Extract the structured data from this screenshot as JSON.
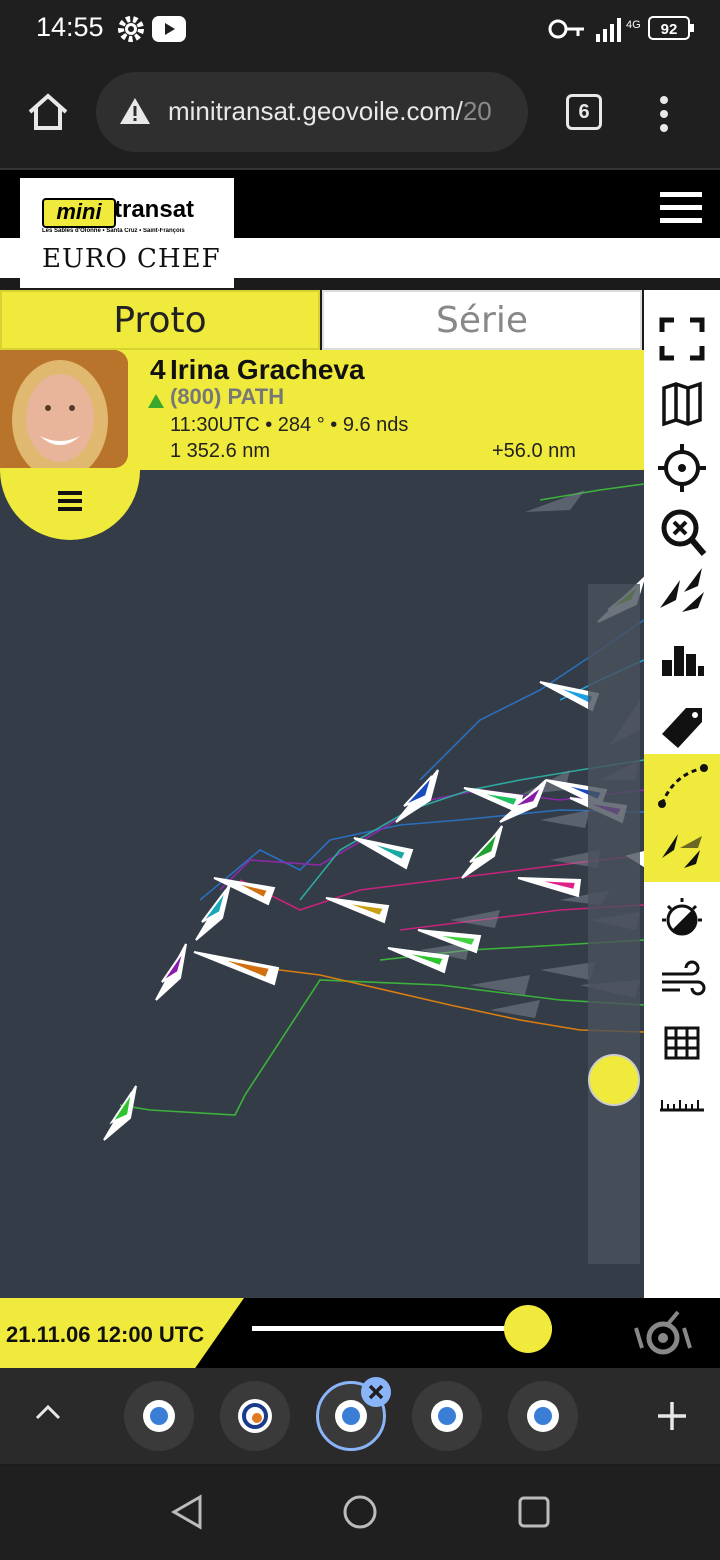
{
  "status_bar": {
    "time": "14:55",
    "network": "4G",
    "battery": "92"
  },
  "browser": {
    "url_main": "minitransat.geovoile.com/",
    "url_rest": "20",
    "tab_count": "6"
  },
  "site": {
    "logo_mini": "mini",
    "logo_transat": "transat",
    "logo_sub": "Les Sables d'Olonne • Santa Cruz • Saint-François",
    "sponsor": "EURO CHEF"
  },
  "tabs": {
    "proto": "Proto",
    "serie": "Série"
  },
  "skipper": {
    "rank": "4",
    "name": "Irina Gracheva",
    "boat": "(800) PATH",
    "info": "11:30UTC • 284 ° • 9.6 nds",
    "distance": "1 352.6 nm",
    "delta": "+56.0 nm"
  },
  "timeline": {
    "date": "21.11.06 12:00 UTC",
    "position": 0.92
  },
  "toolbar": [
    "fullscreen-icon",
    "map-icon",
    "target-icon",
    "zoom-reset-icon",
    "boats-icon",
    "ranking-icon",
    "tag-icon",
    "trajectory-icon",
    "fleet-icon",
    "weather-icon",
    "wind-icon",
    "grid-icon",
    "ruler-icon"
  ],
  "tab_switcher": {
    "active_index": 2,
    "count": 5
  },
  "colors": {
    "accent": "#f0ea3c",
    "map": "#343c47"
  }
}
